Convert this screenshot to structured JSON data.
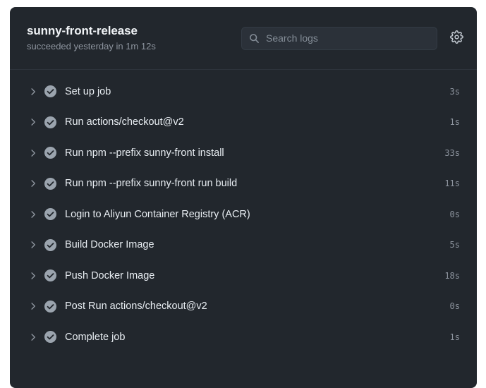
{
  "header": {
    "title": "sunny-front-release",
    "status_text": "succeeded yesterday in 1m 12s",
    "search": {
      "placeholder": "Search logs",
      "value": "",
      "icon": "search-icon"
    },
    "settings_icon": "gear-icon"
  },
  "steps": [
    {
      "label": "Set up job",
      "duration": "3s",
      "status": "success",
      "expand_icon": "chevron-right-icon",
      "status_icon": "check-circle-icon"
    },
    {
      "label": "Run actions/checkout@v2",
      "duration": "1s",
      "status": "success",
      "expand_icon": "chevron-right-icon",
      "status_icon": "check-circle-icon"
    },
    {
      "label": "Run npm --prefix sunny-front install",
      "duration": "33s",
      "status": "success",
      "expand_icon": "chevron-right-icon",
      "status_icon": "check-circle-icon"
    },
    {
      "label": "Run npm --prefix sunny-front run build",
      "duration": "11s",
      "status": "success",
      "expand_icon": "chevron-right-icon",
      "status_icon": "check-circle-icon"
    },
    {
      "label": "Login to Aliyun Container Registry (ACR)",
      "duration": "0s",
      "status": "success",
      "expand_icon": "chevron-right-icon",
      "status_icon": "check-circle-icon"
    },
    {
      "label": "Build Docker Image",
      "duration": "5s",
      "status": "success",
      "expand_icon": "chevron-right-icon",
      "status_icon": "check-circle-icon"
    },
    {
      "label": "Push Docker Image",
      "duration": "18s",
      "status": "success",
      "expand_icon": "chevron-right-icon",
      "status_icon": "check-circle-icon"
    },
    {
      "label": "Post Run actions/checkout@v2",
      "duration": "0s",
      "status": "success",
      "expand_icon": "chevron-right-icon",
      "status_icon": "check-circle-icon"
    },
    {
      "label": "Complete job",
      "duration": "1s",
      "status": "success",
      "expand_icon": "chevron-right-icon",
      "status_icon": "check-circle-icon"
    }
  ],
  "colors": {
    "page_background": "#ffffff",
    "card_background": "#22272d",
    "divider": "#2d333b",
    "search_background": "#2b3139",
    "text_primary": "#e8edf2",
    "text_muted": "#8d949e",
    "status_success_icon": "#9ba4ae"
  }
}
